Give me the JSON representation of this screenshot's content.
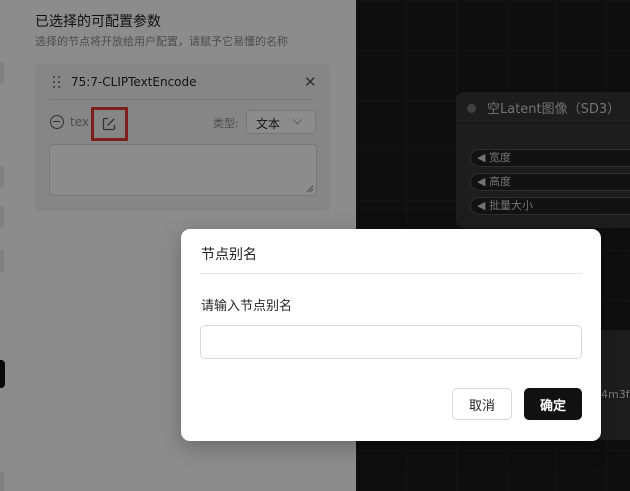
{
  "panel": {
    "title": "已选择的可配置参数",
    "subtitle": "选择的节点将开放给用户配置，请赋予它易懂的名称"
  },
  "card": {
    "node_name": "75:7-CLIPTextEncode",
    "param_label": "tex",
    "type_label": "类型:",
    "type_value": "文本",
    "textarea_value": ""
  },
  "canvas": {
    "node_title": "空Latent图像（SD3）",
    "widgets": [
      "◀ 宽度",
      "◀ 高度",
      "◀ 批量大小"
    ],
    "partial_text": "4m3f"
  },
  "modal": {
    "title": "节点别名",
    "label": "请输入节点别名",
    "input_value": "",
    "cancel_label": "取消",
    "confirm_label": "确定"
  },
  "colors": {
    "highlight": "#e53935",
    "primary_button": "#111111"
  },
  "icons": [
    "drag-handle-icon",
    "close-icon",
    "minus-circle-icon",
    "edit-icon",
    "chevron-down-icon"
  ]
}
